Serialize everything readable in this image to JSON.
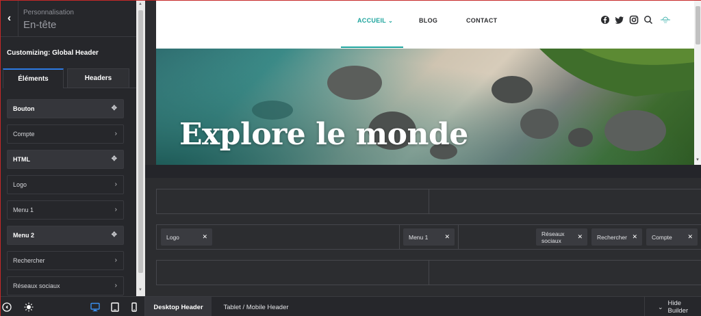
{
  "sidebar": {
    "breadcrumb": "Personnalisation",
    "section_title": "En-tête",
    "customizing_label": "Customizing: Global Header",
    "tabs": [
      {
        "label": "Éléments",
        "active": true
      },
      {
        "label": "Headers",
        "active": false
      }
    ],
    "elements": [
      {
        "label": "Bouton",
        "type": "draggable",
        "icon": "move-icon"
      },
      {
        "label": "Compte",
        "type": "link",
        "icon": "chevron-right-icon"
      },
      {
        "label": "HTML",
        "type": "draggable",
        "icon": "move-icon"
      },
      {
        "label": "Logo",
        "type": "link",
        "icon": "chevron-right-icon"
      },
      {
        "label": "Menu 1",
        "type": "link",
        "icon": "chevron-right-icon"
      },
      {
        "label": "Menu 2",
        "type": "draggable",
        "icon": "move-icon"
      },
      {
        "label": "Rechercher",
        "type": "link",
        "icon": "chevron-right-icon"
      },
      {
        "label": "Réseaux sociaux",
        "type": "link",
        "icon": "chevron-right-icon"
      }
    ]
  },
  "preview": {
    "nav": {
      "home": "ACCUEIL",
      "blog": "BLOG",
      "contact": "CONTACT",
      "social_icons": [
        "facebook-icon",
        "twitter-icon",
        "instagram-icon",
        "search-icon",
        "logo-icon"
      ]
    },
    "hero_title": "Explore le monde",
    "accent_color": "#1ba39c"
  },
  "builder": {
    "main_row": {
      "logo": "Logo",
      "menu": "Menu 1",
      "social": "Réseaux sociaux",
      "search": "Rechercher",
      "account": "Compte"
    }
  },
  "bottombar": {
    "desktop_tab": "Desktop Header",
    "tablet_tab": "Tablet / Mobile Header",
    "hide_builder": "Hide Builder"
  }
}
